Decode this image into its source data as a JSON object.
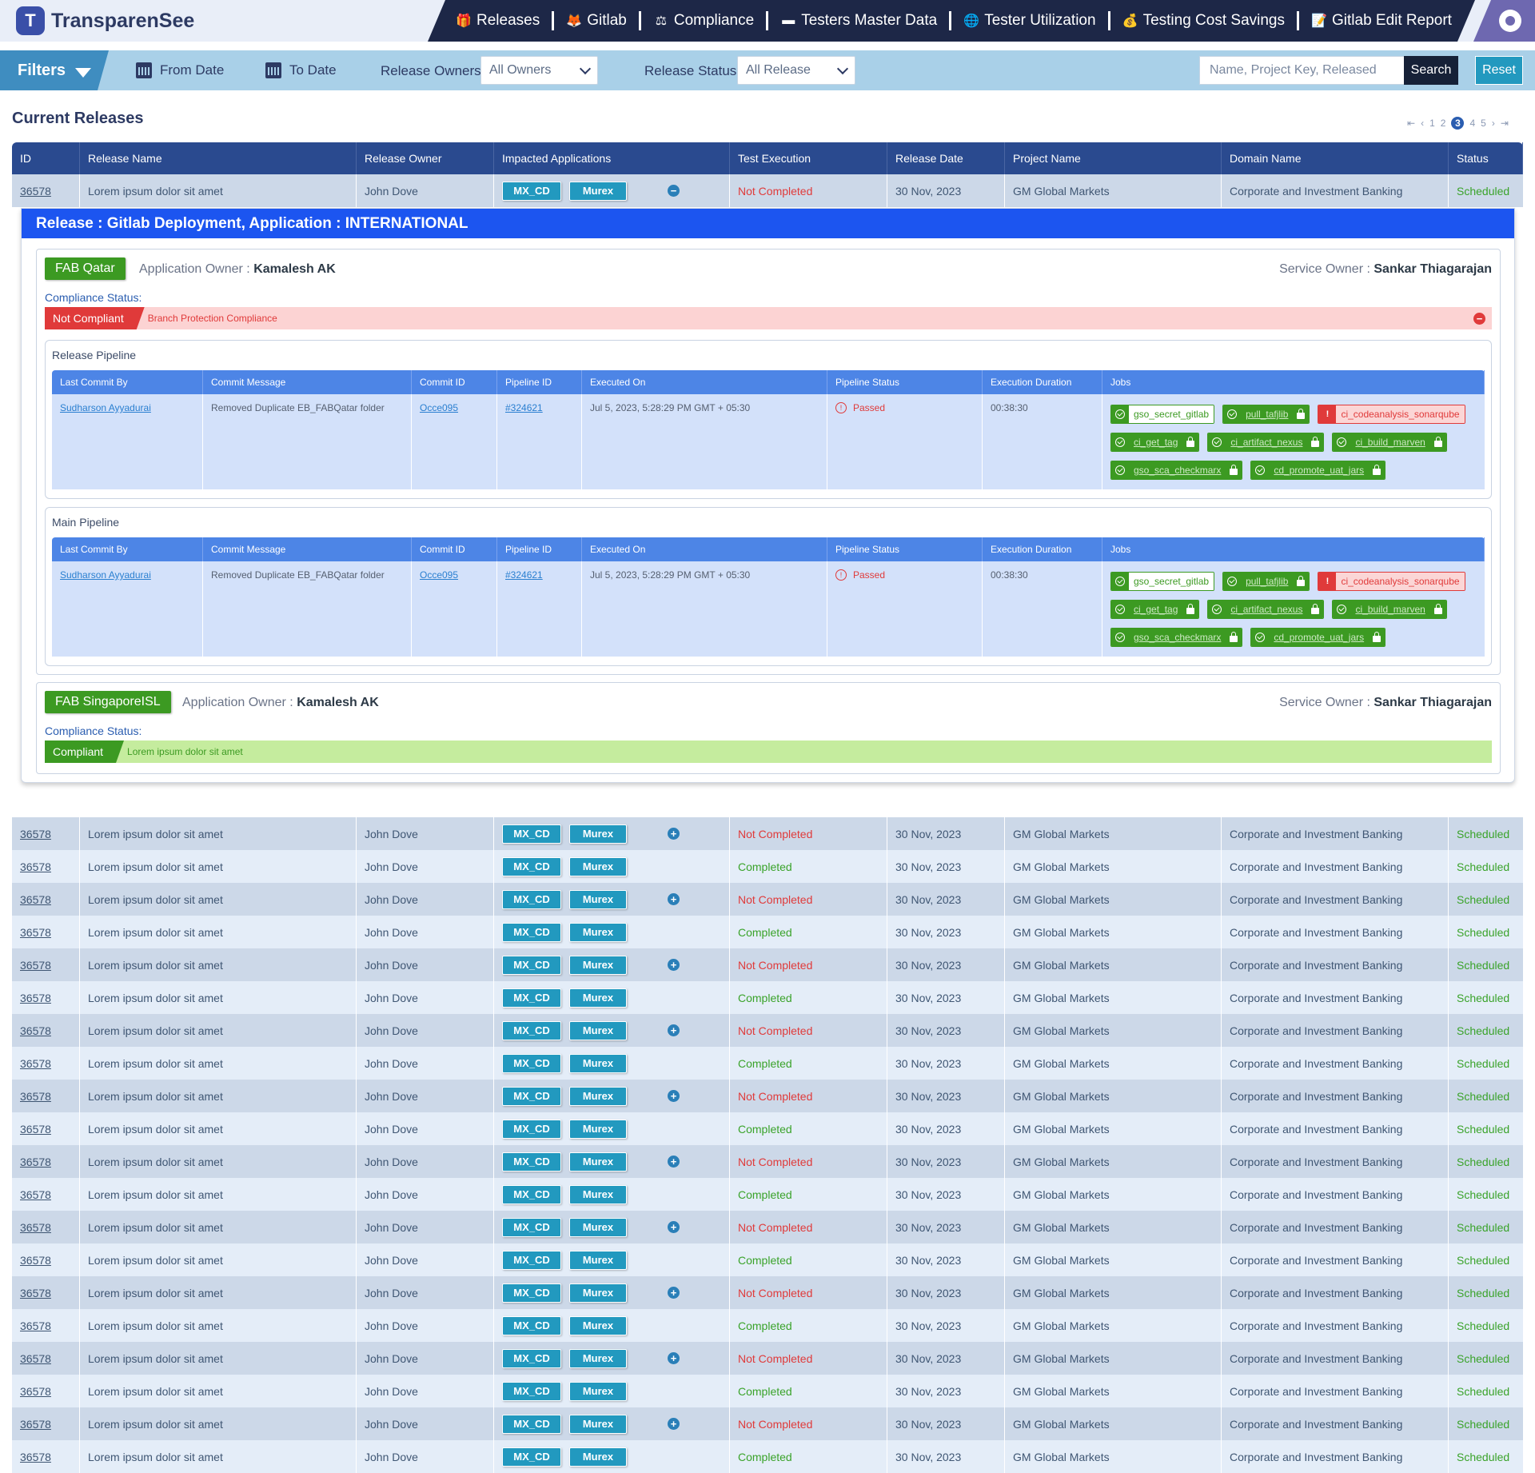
{
  "app": {
    "logo_letter": "T",
    "name": "TransparenSee"
  },
  "nav": [
    "Releases",
    "Gitlab",
    "Compliance",
    "Testers Master Data",
    "Tester Utilization",
    "Testing Cost Savings",
    "Gitlab Edit Report"
  ],
  "filters": {
    "title": "Filters",
    "from_date": "From Date",
    "to_date": "To Date",
    "owners_label": "Release Owners",
    "owners_value": "All Owners",
    "status_label": "Release Status",
    "status_value": "All Release",
    "search_placeholder": "Name, Project Key, Released",
    "search_btn": "Search",
    "reset_btn": "Reset"
  },
  "section_title": "Current Releases",
  "pagination": {
    "pages": [
      "1",
      "2",
      "3",
      "4",
      "5"
    ],
    "current": "3"
  },
  "table": {
    "headers": [
      "ID",
      "Release Name",
      "Release Owner",
      "Impacted Applications",
      "Test Execution",
      "Release Date",
      "Project Name",
      "Domain Name",
      "Status"
    ],
    "first_row": {
      "id": "36578",
      "name": "Lorem ipsum dolor sit amet",
      "owner": "John Dove",
      "apps": [
        "MX_CD",
        "Murex"
      ],
      "test": "Not Completed",
      "date": "30 Nov, 2023",
      "project": "GM Global Markets",
      "domain": "Corporate and Investment Banking",
      "status": "Scheduled"
    },
    "rows": [
      {
        "id": "36578",
        "name": "Lorem ipsum dolor sit amet",
        "owner": "John Dove",
        "apps": [
          "MX_CD",
          "Murex"
        ],
        "test": "Not Completed",
        "date": "30 Nov, 2023",
        "project": "GM Global Markets",
        "domain": "Corporate and Investment Banking",
        "status": "Scheduled",
        "expandable": true
      },
      {
        "id": "36578",
        "name": "Lorem ipsum dolor sit amet",
        "owner": "John Dove",
        "apps": [
          "MX_CD",
          "Murex"
        ],
        "test": "Completed",
        "date": "30 Nov, 2023",
        "project": "GM Global Markets",
        "domain": "Corporate and Investment Banking",
        "status": "Scheduled",
        "expandable": false
      },
      {
        "id": "36578",
        "name": "Lorem ipsum dolor sit amet",
        "owner": "John Dove",
        "apps": [
          "MX_CD",
          "Murex"
        ],
        "test": "Not Completed",
        "date": "30 Nov, 2023",
        "project": "GM Global Markets",
        "domain": "Corporate and Investment Banking",
        "status": "Scheduled",
        "expandable": true
      },
      {
        "id": "36578",
        "name": "Lorem ipsum dolor sit amet",
        "owner": "John Dove",
        "apps": [
          "MX_CD",
          "Murex"
        ],
        "test": "Completed",
        "date": "30 Nov, 2023",
        "project": "GM Global Markets",
        "domain": "Corporate and Investment Banking",
        "status": "Scheduled",
        "expandable": false
      },
      {
        "id": "36578",
        "name": "Lorem ipsum dolor sit amet",
        "owner": "John Dove",
        "apps": [
          "MX_CD",
          "Murex"
        ],
        "test": "Not Completed",
        "date": "30 Nov, 2023",
        "project": "GM Global Markets",
        "domain": "Corporate and Investment Banking",
        "status": "Scheduled",
        "expandable": true
      },
      {
        "id": "36578",
        "name": "Lorem ipsum dolor sit amet",
        "owner": "John Dove",
        "apps": [
          "MX_CD",
          "Murex"
        ],
        "test": "Completed",
        "date": "30 Nov, 2023",
        "project": "GM Global Markets",
        "domain": "Corporate and Investment Banking",
        "status": "Scheduled",
        "expandable": false
      },
      {
        "id": "36578",
        "name": "Lorem ipsum dolor sit amet",
        "owner": "John Dove",
        "apps": [
          "MX_CD",
          "Murex"
        ],
        "test": "Not Completed",
        "date": "30 Nov, 2023",
        "project": "GM Global Markets",
        "domain": "Corporate and Investment Banking",
        "status": "Scheduled",
        "expandable": true
      },
      {
        "id": "36578",
        "name": "Lorem ipsum dolor sit amet",
        "owner": "John Dove",
        "apps": [
          "MX_CD",
          "Murex"
        ],
        "test": "Completed",
        "date": "30 Nov, 2023",
        "project": "GM Global Markets",
        "domain": "Corporate and Investment Banking",
        "status": "Scheduled",
        "expandable": false
      },
      {
        "id": "36578",
        "name": "Lorem ipsum dolor sit amet",
        "owner": "John Dove",
        "apps": [
          "MX_CD",
          "Murex"
        ],
        "test": "Not Completed",
        "date": "30 Nov, 2023",
        "project": "GM Global Markets",
        "domain": "Corporate and Investment Banking",
        "status": "Scheduled",
        "expandable": true
      },
      {
        "id": "36578",
        "name": "Lorem ipsum dolor sit amet",
        "owner": "John Dove",
        "apps": [
          "MX_CD",
          "Murex"
        ],
        "test": "Completed",
        "date": "30 Nov, 2023",
        "project": "GM Global Markets",
        "domain": "Corporate and Investment Banking",
        "status": "Scheduled",
        "expandable": false
      },
      {
        "id": "36578",
        "name": "Lorem ipsum dolor sit amet",
        "owner": "John Dove",
        "apps": [
          "MX_CD",
          "Murex"
        ],
        "test": "Not Completed",
        "date": "30 Nov, 2023",
        "project": "GM Global Markets",
        "domain": "Corporate and Investment Banking",
        "status": "Scheduled",
        "expandable": true
      },
      {
        "id": "36578",
        "name": "Lorem ipsum dolor sit amet",
        "owner": "John Dove",
        "apps": [
          "MX_CD",
          "Murex"
        ],
        "test": "Completed",
        "date": "30 Nov, 2023",
        "project": "GM Global Markets",
        "domain": "Corporate and Investment Banking",
        "status": "Scheduled",
        "expandable": false
      },
      {
        "id": "36578",
        "name": "Lorem ipsum dolor sit amet",
        "owner": "John Dove",
        "apps": [
          "MX_CD",
          "Murex"
        ],
        "test": "Not Completed",
        "date": "30 Nov, 2023",
        "project": "GM Global Markets",
        "domain": "Corporate and Investment Banking",
        "status": "Scheduled",
        "expandable": true
      },
      {
        "id": "36578",
        "name": "Lorem ipsum dolor sit amet",
        "owner": "John Dove",
        "apps": [
          "MX_CD",
          "Murex"
        ],
        "test": "Completed",
        "date": "30 Nov, 2023",
        "project": "GM Global Markets",
        "domain": "Corporate and Investment Banking",
        "status": "Scheduled",
        "expandable": false
      },
      {
        "id": "36578",
        "name": "Lorem ipsum dolor sit amet",
        "owner": "John Dove",
        "apps": [
          "MX_CD",
          "Murex"
        ],
        "test": "Not Completed",
        "date": "30 Nov, 2023",
        "project": "GM Global Markets",
        "domain": "Corporate and Investment Banking",
        "status": "Scheduled",
        "expandable": true
      },
      {
        "id": "36578",
        "name": "Lorem ipsum dolor sit amet",
        "owner": "John Dove",
        "apps": [
          "MX_CD",
          "Murex"
        ],
        "test": "Completed",
        "date": "30 Nov, 2023",
        "project": "GM Global Markets",
        "domain": "Corporate and Investment Banking",
        "status": "Scheduled",
        "expandable": false
      },
      {
        "id": "36578",
        "name": "Lorem ipsum dolor sit amet",
        "owner": "John Dove",
        "apps": [
          "MX_CD",
          "Murex"
        ],
        "test": "Not Completed",
        "date": "30 Nov, 2023",
        "project": "GM Global Markets",
        "domain": "Corporate and Investment Banking",
        "status": "Scheduled",
        "expandable": true
      },
      {
        "id": "36578",
        "name": "Lorem ipsum dolor sit amet",
        "owner": "John Dove",
        "apps": [
          "MX_CD",
          "Murex"
        ],
        "test": "Completed",
        "date": "30 Nov, 2023",
        "project": "GM Global Markets",
        "domain": "Corporate and Investment Banking",
        "status": "Scheduled",
        "expandable": false
      },
      {
        "id": "36578",
        "name": "Lorem ipsum dolor sit amet",
        "owner": "John Dove",
        "apps": [
          "MX_CD",
          "Murex"
        ],
        "test": "Not Completed",
        "date": "30 Nov, 2023",
        "project": "GM Global Markets",
        "domain": "Corporate and Investment Banking",
        "status": "Scheduled",
        "expandable": true
      },
      {
        "id": "36578",
        "name": "Lorem ipsum dolor sit amet",
        "owner": "John Dove",
        "apps": [
          "MX_CD",
          "Murex"
        ],
        "test": "Completed",
        "date": "30 Nov, 2023",
        "project": "GM Global Markets",
        "domain": "Corporate and Investment Banking",
        "status": "Scheduled",
        "expandable": false
      }
    ]
  },
  "expand": {
    "title": "Release : Gitlab Deployment, Application : INTERNATIONAL",
    "app1": {
      "name": "FAB Qatar",
      "owner_label": "Application Owner :",
      "owner": "Kamalesh AK",
      "service_label": "Service Owner :",
      "service": "Sankar Thiagarajan",
      "compliance_label": "Compliance Status:",
      "compliance_tag": "Not Compliant",
      "compliance_text": "Branch Protection Compliance"
    },
    "app2": {
      "name": "FAB SingaporeISL",
      "owner_label": "Application Owner :",
      "owner": "Kamalesh AK",
      "service_label": "Service Owner :",
      "service": "Sankar Thiagarajan",
      "compliance_label": "Compliance Status:",
      "compliance_tag": "Compliant",
      "compliance_text": "Lorem ipsum dolor sit amet"
    },
    "pipeline_headers": [
      "Last Commit By",
      "Commit Message",
      "Commit ID",
      "Pipeline ID",
      "Executed On",
      "Pipeline Status",
      "Execution Duration",
      "Jobs"
    ],
    "release_pipeline": {
      "title": "Release Pipeline",
      "commit_by": "Sudharson Ayyadurai",
      "message": "Removed Duplicate EB_FABQatar folder",
      "commit_id": "Occe095",
      "pipeline_id": "#324621",
      "executed": "Jul 5, 2023, 5:28:29 PM GMT + 05:30",
      "status": "Passed",
      "duration": "00:38:30"
    },
    "main_pipeline": {
      "title": "Main Pipeline",
      "commit_by": "Sudharson Ayyadurai",
      "message": "Removed Duplicate EB_FABQatar folder",
      "commit_id": "Occe095",
      "pipeline_id": "#324621",
      "executed": "Jul 5, 2023, 5:28:29 PM GMT + 05:30",
      "status": "Passed",
      "duration": "00:38:30"
    },
    "jobs": [
      {
        "name": "gso_secret_gitlab",
        "state": "passed"
      },
      {
        "name": "pull_tafjlib",
        "state": "manual"
      },
      {
        "name": "ci_codeanalysis_sonarqube",
        "state": "failed"
      },
      {
        "name": "ci_get_tag",
        "state": "manual"
      },
      {
        "name": "ci_artifact_nexus",
        "state": "manual"
      },
      {
        "name": "ci_build_marven",
        "state": "manual"
      },
      {
        "name": "gso_sca_checkmarx",
        "state": "manual"
      },
      {
        "name": "cd_promote_uat_jars",
        "state": "manual"
      }
    ]
  },
  "colors": {
    "nav_bg": "#1d2747",
    "header_bg": "#2a4a8f",
    "accent": "#2299bf",
    "expand_head": "#1c55f0",
    "success": "#3c9a22",
    "danger": "#e03a3a"
  }
}
